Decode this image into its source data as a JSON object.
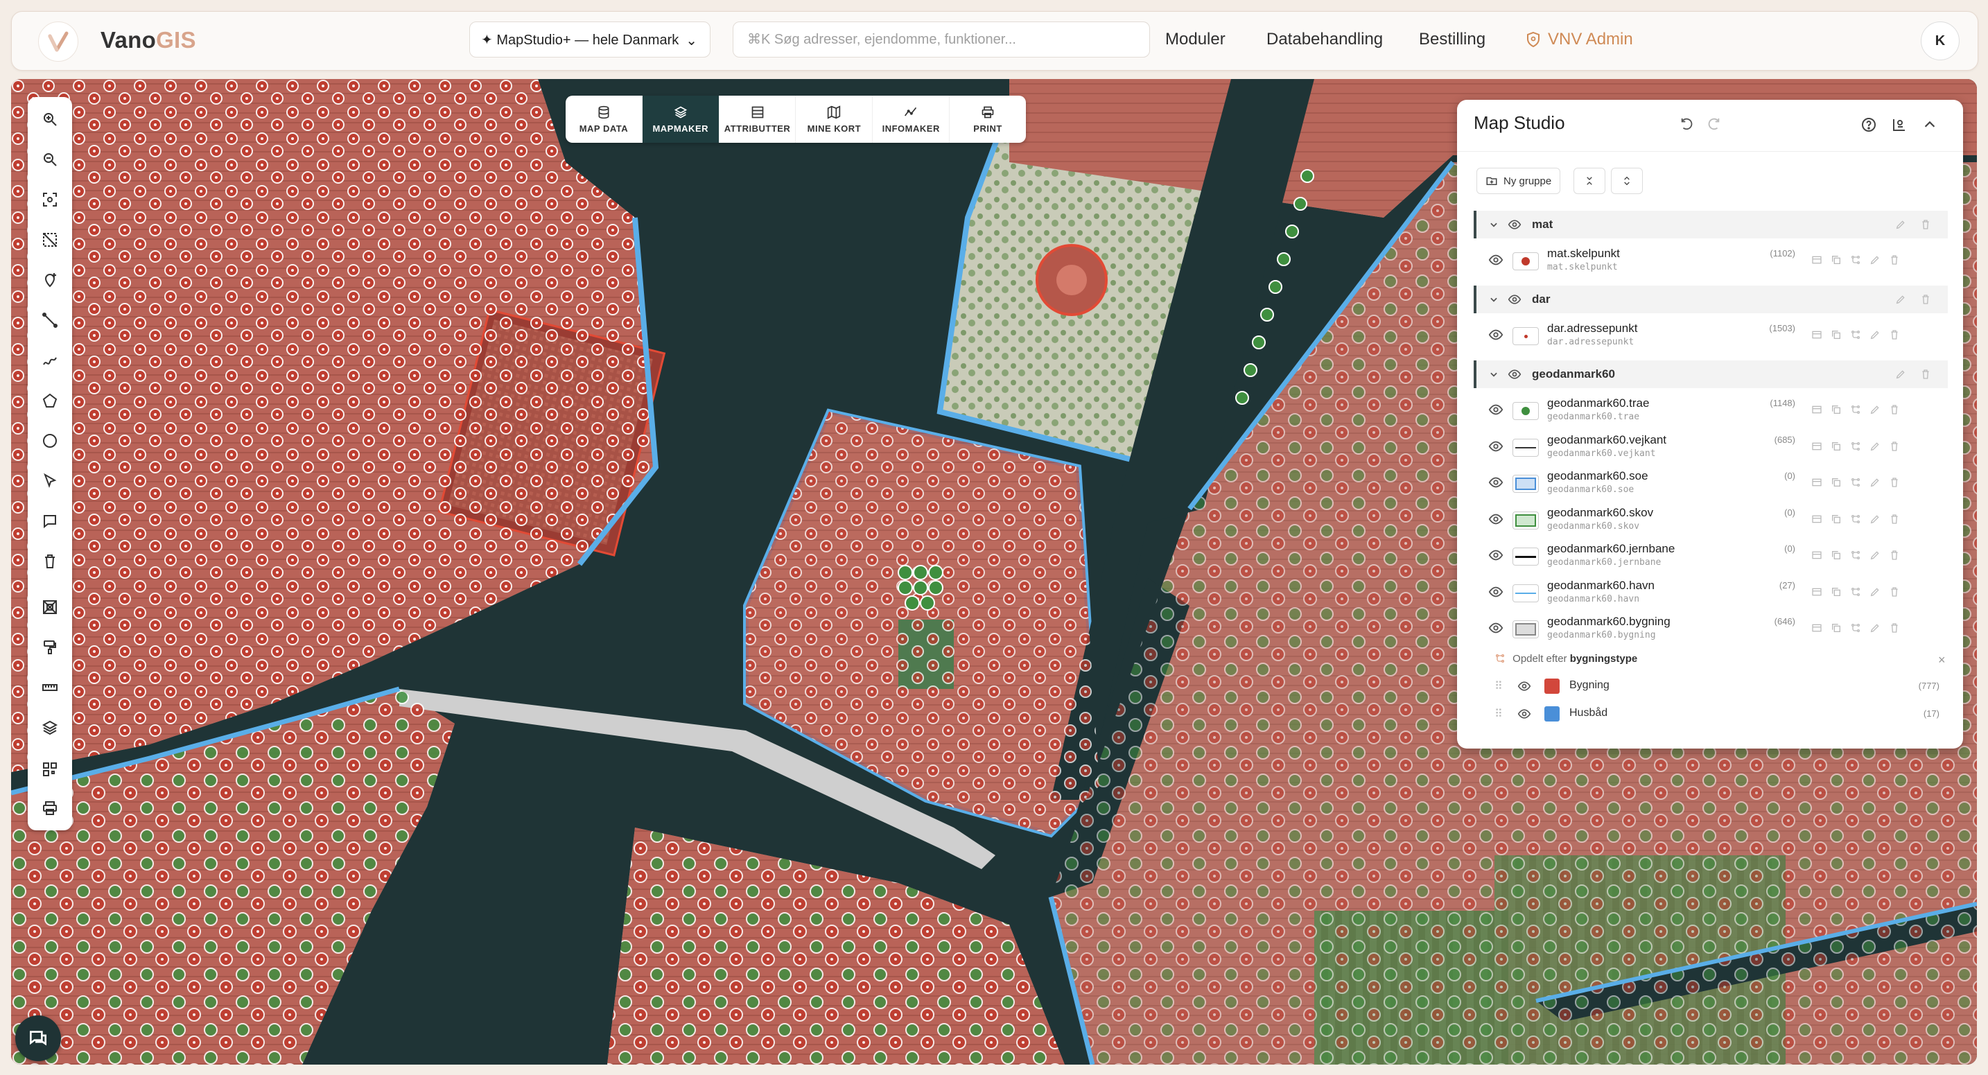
{
  "header": {
    "brand_part1": "Vano",
    "brand_part2": "GIS",
    "dataset_label": "✦ MapStudio+ — hele Danmark",
    "search_placeholder": "⌘K Søg adresser, ejendomme, funktioner...",
    "nav": [
      "Moduler",
      "Databehandling",
      "Bestilling"
    ],
    "admin_label": "VNV Admin",
    "avatar_initial": "K"
  },
  "tabs": [
    {
      "label": "MAP DATA",
      "icon": "database-icon",
      "active": false
    },
    {
      "label": "MAPMAKER",
      "icon": "layers-icon",
      "active": true
    },
    {
      "label": "ATTRIBUTTER",
      "icon": "table-icon",
      "active": false
    },
    {
      "label": "MINE KORT",
      "icon": "map-icon",
      "active": false
    },
    {
      "label": "INFOMAKER",
      "icon": "chart-icon",
      "active": false
    },
    {
      "label": "PRINT",
      "icon": "printer-icon",
      "active": false
    }
  ],
  "toolbar_icons": [
    "zoom-in-icon",
    "zoom-out-icon",
    "zoom-extent-icon",
    "select-area-icon",
    "add-point-icon",
    "draw-line-icon",
    "freehand-icon",
    "polygon-icon",
    "circle-icon",
    "pointer-icon",
    "comment-icon",
    "delete-icon",
    "clip-icon",
    "brush-icon",
    "measure-icon",
    "layers-icon",
    "qr-icon",
    "printer-icon"
  ],
  "panel": {
    "title": "Map Studio",
    "new_group_label": "Ny gruppe",
    "groups": [
      {
        "name": "mat",
        "layers": [
          {
            "name": "mat.skelpunkt",
            "source": "mat.skelpunkt",
            "count": "(1102)",
            "symbol": "red-dot"
          }
        ]
      },
      {
        "name": "dar",
        "layers": [
          {
            "name": "dar.adressepunkt",
            "source": "dar.adressepunkt",
            "count": "(1503)",
            "symbol": "small-red-dot"
          }
        ]
      },
      {
        "name": "geodanmark60",
        "layers": [
          {
            "name": "geodanmark60.trae",
            "source": "geodanmark60.trae",
            "count": "(1148)",
            "symbol": "green-dot"
          },
          {
            "name": "geodanmark60.vejkant",
            "source": "geodanmark60.vejkant",
            "count": "(685)",
            "symbol": "black-line"
          },
          {
            "name": "geodanmark60.soe",
            "source": "geodanmark60.soe",
            "count": "(0)",
            "symbol": "blue-fill"
          },
          {
            "name": "geodanmark60.skov",
            "source": "geodanmark60.skov",
            "count": "(0)",
            "symbol": "green-fill"
          },
          {
            "name": "geodanmark60.jernbane",
            "source": "geodanmark60.jernbane",
            "count": "(0)",
            "symbol": "black-thick-line"
          },
          {
            "name": "geodanmark60.havn",
            "source": "geodanmark60.havn",
            "count": "(27)",
            "symbol": "blue-line"
          },
          {
            "name": "geodanmark60.bygning",
            "source": "geodanmark60.bygning",
            "count": "(646)",
            "symbol": "grey-fill"
          }
        ]
      }
    ],
    "split_prefix": "Opdelt efter",
    "split_field": "bygningstype",
    "categories": [
      {
        "name": "Bygning",
        "count": "(777)",
        "color": "#d2473b"
      },
      {
        "name": "Husbåd",
        "count": "(17)",
        "color": "#4a8fd8"
      }
    ]
  },
  "colors": {
    "accent": "#1f3d3f",
    "brand_orange": "#d8a48b",
    "admin_orange": "#cf8a55",
    "point_red": "#c0392b",
    "point_green": "#3f8f3f",
    "building_outline": "#e24a35",
    "harbour_blue": "#5aaee8",
    "water": "#1f3335"
  }
}
